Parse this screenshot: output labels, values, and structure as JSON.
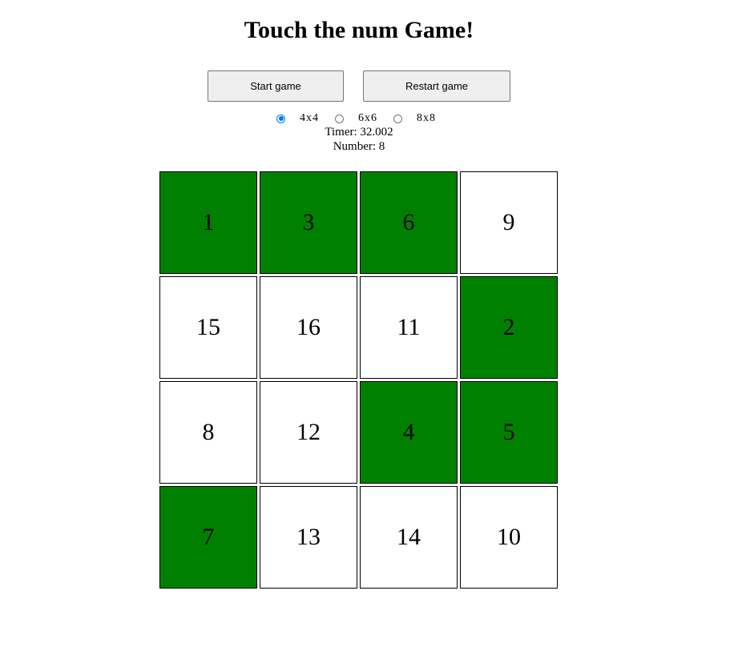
{
  "title": "Touch the num Game!",
  "buttons": {
    "start": "Start game",
    "restart": "Restart game"
  },
  "sizes": [
    {
      "label": "4x4",
      "checked": true
    },
    {
      "label": "6x6",
      "checked": false
    },
    {
      "label": "8x8",
      "checked": false
    }
  ],
  "status": {
    "timer": "Timer: 32.002",
    "number": "Number: 8"
  },
  "colors": {
    "found": "#008000",
    "unfound": "#ffffff",
    "radio_accent": "#0075ff"
  },
  "board": {
    "cells": [
      {
        "value": "1",
        "found": true
      },
      {
        "value": "3",
        "found": true
      },
      {
        "value": "6",
        "found": true
      },
      {
        "value": "9",
        "found": false
      },
      {
        "value": "15",
        "found": false
      },
      {
        "value": "16",
        "found": false
      },
      {
        "value": "11",
        "found": false
      },
      {
        "value": "2",
        "found": true
      },
      {
        "value": "8",
        "found": false
      },
      {
        "value": "12",
        "found": false
      },
      {
        "value": "4",
        "found": true
      },
      {
        "value": "5",
        "found": true
      },
      {
        "value": "7",
        "found": true
      },
      {
        "value": "13",
        "found": false
      },
      {
        "value": "14",
        "found": false
      },
      {
        "value": "10",
        "found": false
      }
    ]
  }
}
